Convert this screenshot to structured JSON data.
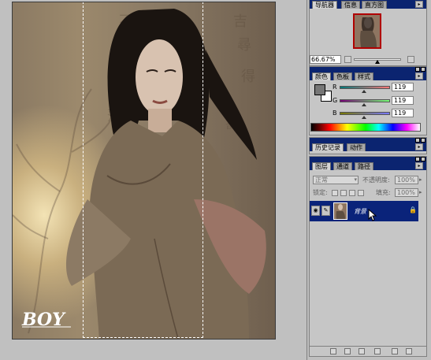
{
  "navigator": {
    "tabs": [
      "导航器",
      "信息",
      "直方图"
    ],
    "zoom": "66.67%"
  },
  "color": {
    "tabs": [
      "颜色",
      "色板",
      "样式"
    ],
    "channels": [
      {
        "label": "R",
        "value": "119"
      },
      {
        "label": "G",
        "value": "119"
      },
      {
        "label": "B",
        "value": "119"
      }
    ],
    "foreground": "#777777",
    "background": "#ffffff"
  },
  "history": {
    "tabs": [
      "历史记录",
      "动作"
    ]
  },
  "layers": {
    "tabs": [
      "图层",
      "通道",
      "路径"
    ],
    "blend_mode": "正常",
    "opacity_label": "不透明度:",
    "opacity_value": "100%",
    "lock_label": "锁定:",
    "fill_label": "填充:",
    "fill_value": "100%",
    "layer_name": "背景"
  },
  "document": {
    "watermark": "BOY"
  },
  "colors": {
    "titlebar": "#0b2470",
    "selected_layer": "#0a237a"
  }
}
